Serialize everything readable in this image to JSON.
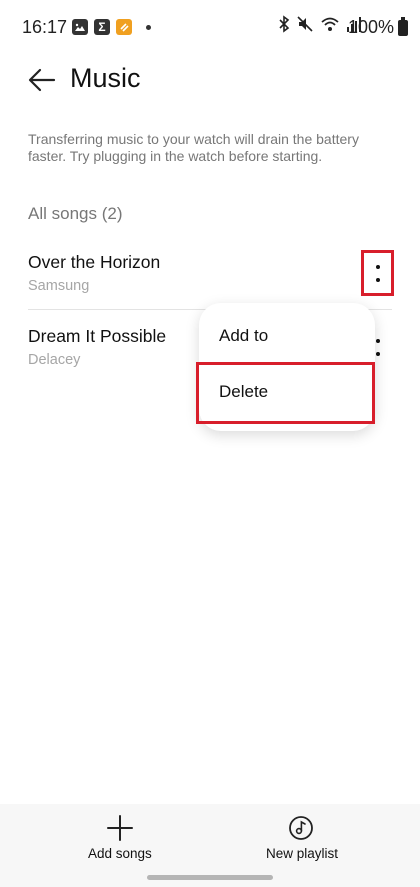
{
  "status_bar": {
    "time": "16:17",
    "battery": "100%",
    "left_icons": [
      "gallery-icon",
      "sigma-app-icon",
      "orange-app-icon",
      "notification-dot-icon"
    ],
    "right_icons": [
      "bluetooth-icon",
      "mute-icon",
      "wifi-icon",
      "signal-icon",
      "battery-icon"
    ]
  },
  "header": {
    "title": "Music",
    "back_icon": "back-arrow-icon"
  },
  "info_text": "Transferring music to your watch will drain the battery faster. Try plugging in the watch before starting.",
  "section": {
    "title": "All songs (2)"
  },
  "songs": [
    {
      "title": "Over the Horizon",
      "artist": "Samsung"
    },
    {
      "title": "Dream It Possible",
      "artist": "Delacey"
    }
  ],
  "popup_menu": {
    "items": [
      {
        "label": "Add to"
      },
      {
        "label": "Delete"
      }
    ]
  },
  "bottom_bar": {
    "add_songs": {
      "label": "Add songs",
      "icon": "plus-icon"
    },
    "new_playlist": {
      "label": "New playlist",
      "icon": "playlist-disc-icon"
    }
  },
  "colors": {
    "highlight": "#d81e2b",
    "secondary_text": "#777777",
    "artist_text": "#a6a6a6",
    "bottom_bar_bg": "#f7f7f7"
  }
}
